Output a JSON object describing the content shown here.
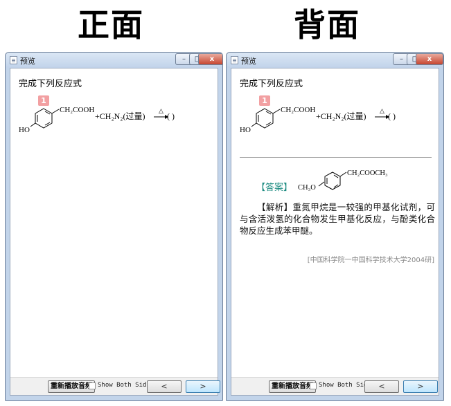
{
  "front": {
    "big_title": "正面",
    "window_title": "预览",
    "question_heading": "完成下列反应式",
    "badge": "1",
    "reaction": {
      "substituent": "CH₂COOH",
      "oh_label": "HO",
      "reagent": "+CH₂N₂(过量)",
      "heat_symbol": "△",
      "blank": "(      )"
    }
  },
  "back": {
    "big_title": "背面",
    "window_title": "预览",
    "question_heading": "完成下列反应式",
    "badge": "1",
    "reaction": {
      "substituent": "CH₂COOH",
      "oh_label": "HO",
      "reagent": "+CH₂N₂(过量)",
      "heat_symbol": "△",
      "blank": "(      )"
    },
    "answer_label": "【答案】",
    "answer_structure": {
      "methoxy_label": "CH₃O",
      "substituent": "CH₂COOCH₃"
    },
    "analysis_tag": "【解析】",
    "analysis_text": "重氮甲烷是一较强的甲基化试剂，可与含活泼氢的化合物发生甲基化反应，与酚类化合物反应生成苯甲醚。",
    "source": "[中国科学院一中国科学技术大学2004研]"
  },
  "footer": {
    "replay_label": "重新播放音频",
    "show_both_label": "Show Both Sides",
    "prev_label": "<",
    "next_label": ">"
  },
  "window_controls": {
    "minimize": "–",
    "maximize": "□",
    "close": "x"
  },
  "colors": {
    "answer_accent": "#1e8c82",
    "badge_bg": "#f2a0a2",
    "window_frame": "#c2d4ea"
  }
}
